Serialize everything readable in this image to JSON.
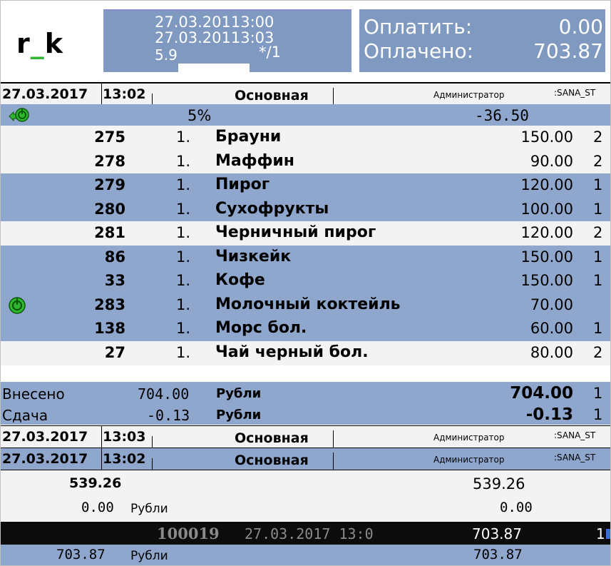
{
  "header": {
    "logo": {
      "left": "r",
      "underscore": "_",
      "right": "k"
    },
    "info": {
      "line1": "27.03.20113:00",
      "line2": "27.03.20113:03",
      "line3_left": "5.9",
      "line3_right": "*/1"
    },
    "pay": {
      "to_pay_label": "Оплатить:",
      "to_pay_value": "0.00",
      "paid_label": "Оплачено:",
      "paid_value": "703.87"
    }
  },
  "order_header_1": {
    "date": "27.03.2017",
    "time": "13:02",
    "menu": "Основная",
    "user": "Администратор",
    "station": ":SANA_ST"
  },
  "discount": {
    "percent": "5%",
    "amount": "-36.50",
    "icon": "discount-coin-icon"
  },
  "items": [
    {
      "code": "275",
      "qty": "1.",
      "name": "Брауни",
      "price": "150.00",
      "col": "2"
    },
    {
      "code": "278",
      "qty": "1.",
      "name": "Маффин",
      "price": "90.00",
      "col": "2"
    },
    {
      "code": "279",
      "qty": "1.",
      "name": "Пирог",
      "price": "120.00",
      "col": "1"
    },
    {
      "code": "280",
      "qty": "1.",
      "name": "Сухофрукты",
      "price": "100.00",
      "col": "1"
    },
    {
      "code": "281",
      "qty": "1.",
      "name": "Черничный пирог",
      "price": "120.00",
      "col": "2"
    },
    {
      "code": "86",
      "qty": "1.",
      "name": "Чизкейк",
      "price": "150.00",
      "col": "1"
    },
    {
      "code": "33",
      "qty": "1.",
      "name": "Кофе",
      "price": "150.00",
      "col": "1"
    },
    {
      "code": "283",
      "qty": "1.",
      "name": "Молочный коктейль",
      "price": "70.00",
      "col": ""
    },
    {
      "code": "138",
      "qty": "1.",
      "name": "Морс бол.",
      "price": "60.00",
      "col": "1"
    },
    {
      "code": "27",
      "qty": "1.",
      "name": "Чай черный бол.",
      "price": "80.00",
      "col": "2"
    }
  ],
  "payment": {
    "deposited_label": "Внесено",
    "deposited_amount": "704.00",
    "deposited_currency": "Рубли",
    "deposited_total": "704.00",
    "deposited_col": "1",
    "change_label": "Сдача",
    "change_amount": "-0.13",
    "change_currency": "Рубли",
    "change_total": "-0.13",
    "change_col": "1"
  },
  "order_header_2": {
    "date": "27.03.2017",
    "time": "13:03",
    "menu": "Основная",
    "user": "Администратор",
    "station": ":SANA_ST"
  },
  "order_header_3": {
    "date": "27.03.2017",
    "time": "13:02",
    "menu": "Основная",
    "user": "Администратор",
    "station": ":SANA_ST"
  },
  "summary": {
    "sum_left": "539.26",
    "sum_right": "539.26",
    "zero_amount": "0.00",
    "zero_currency": "Рубли",
    "zero_right": "0.00"
  },
  "check": {
    "number": "100019",
    "datetime": "27.03.2017 13:0",
    "amount": "703.87",
    "col": "1"
  },
  "final": {
    "amount": "703.87",
    "currency": "Рубли",
    "right": "703.87"
  },
  "colors": {
    "row_blue": "#8fa6cd",
    "row_white": "#f3f3f3",
    "header_box": "#7f99c0",
    "icon_green": "#2fb82f"
  }
}
